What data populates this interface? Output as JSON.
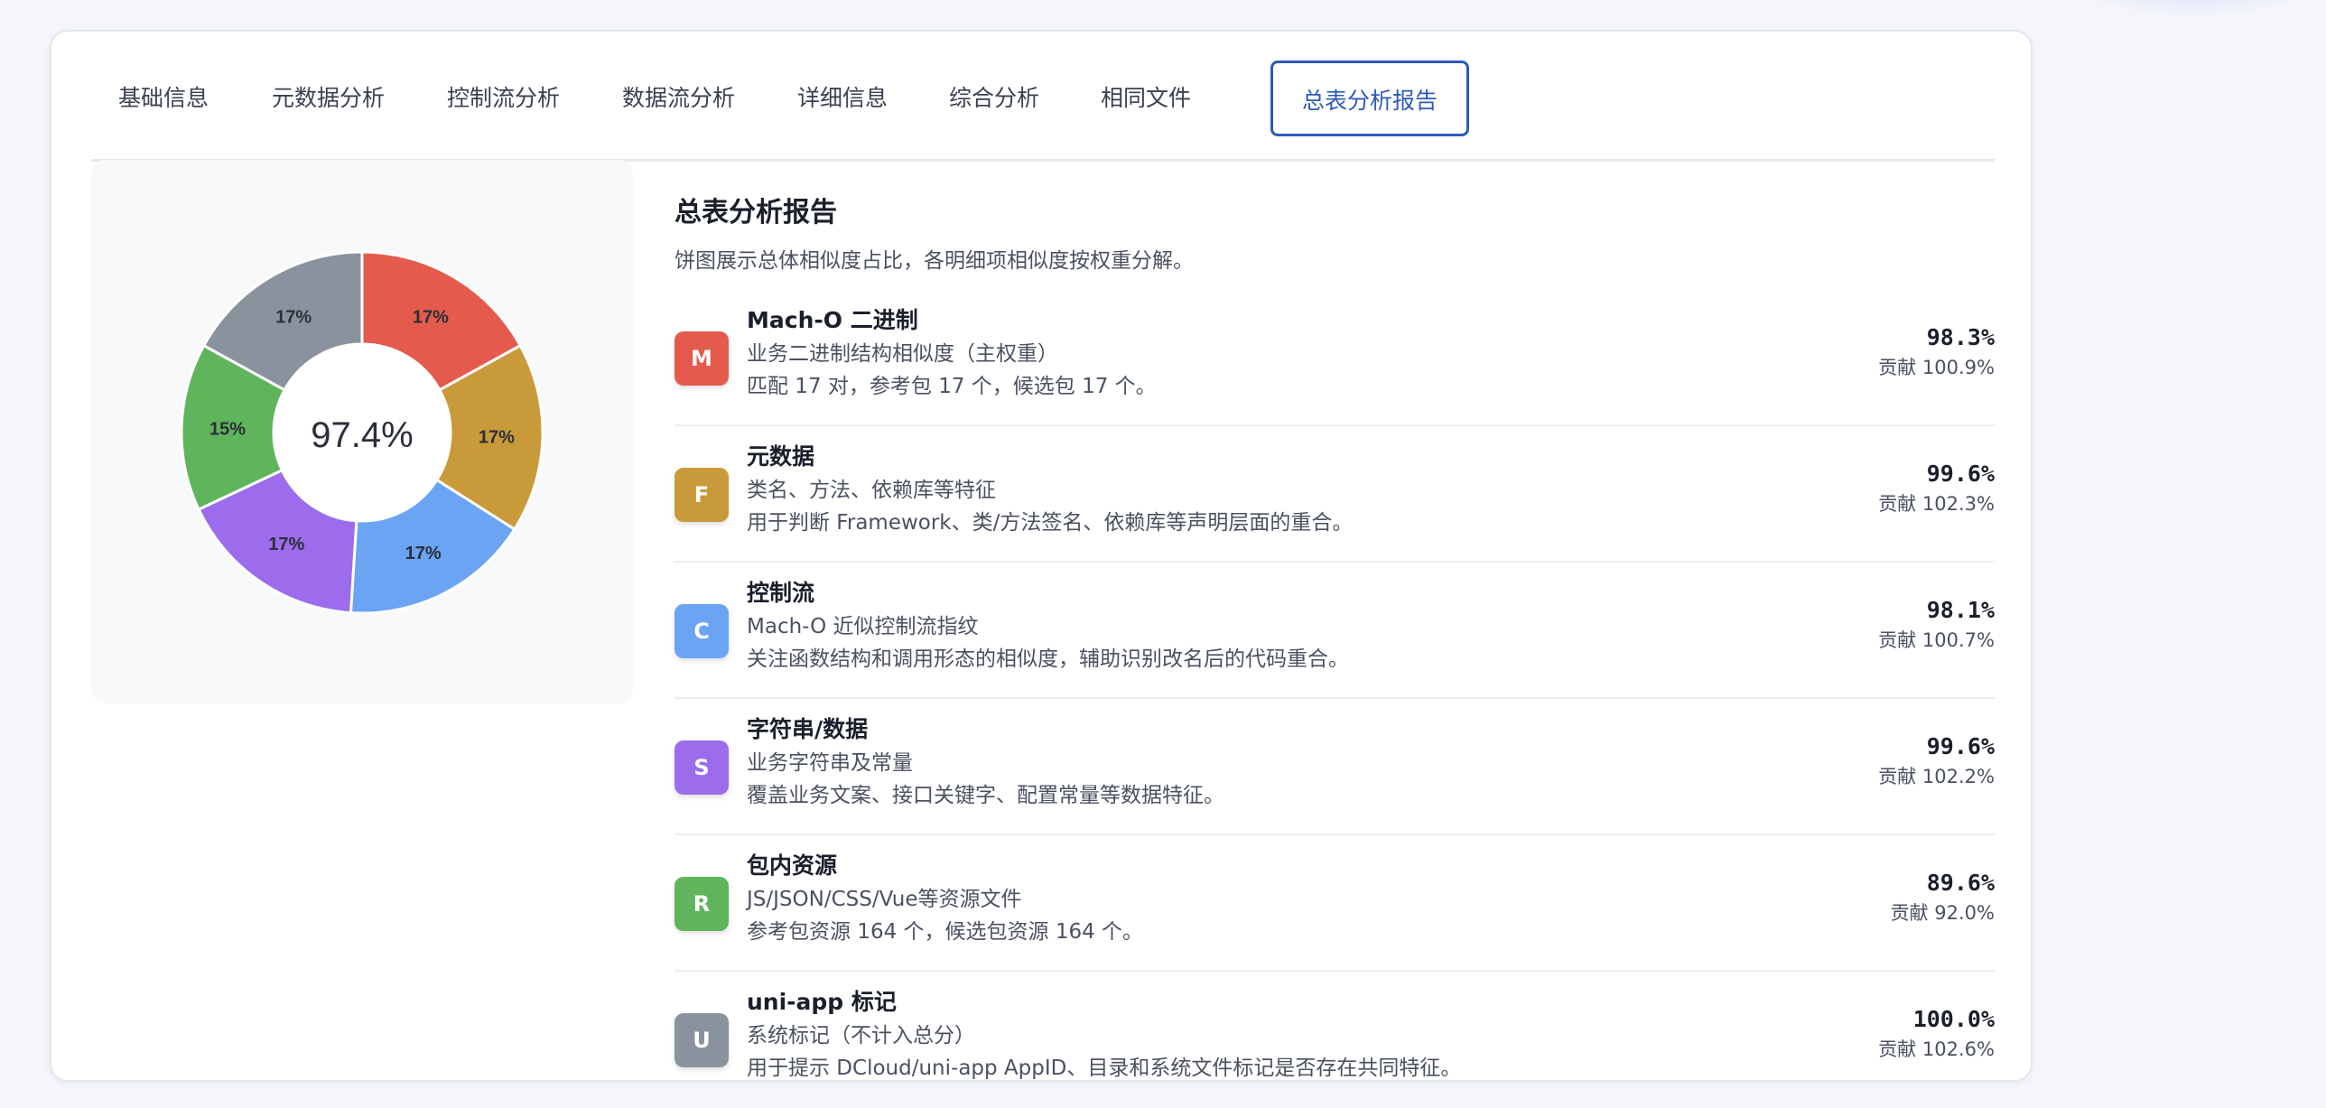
{
  "tabs": [
    {
      "label": "基础信息",
      "active": false
    },
    {
      "label": "元数据分析",
      "active": false
    },
    {
      "label": "控制流分析",
      "active": false
    },
    {
      "label": "数据流分析",
      "active": false
    },
    {
      "label": "详细信息",
      "active": false
    },
    {
      "label": "综合分析",
      "active": false
    },
    {
      "label": "相同文件",
      "active": false
    },
    {
      "label": "总表分析报告",
      "active": true
    }
  ],
  "report": {
    "title": "总表分析报告",
    "subtitle": "饼图展示总体相似度占比，各明细项相似度按权重分解。",
    "items": [
      {
        "badge": "M",
        "color": "#e45a4d",
        "title": "Mach-O 二进制",
        "desc": "业务二进制结构相似度（主权重）",
        "note": "匹配 17 对，参考包 17 个，候选包 17 个。",
        "score": "98.3%",
        "contrib": "贡献 100.9%"
      },
      {
        "badge": "F",
        "color": "#c99a3a",
        "title": "元数据",
        "desc": "类名、方法、依赖库等特征",
        "note": "用于判断 Framework、类/方法签名、依赖库等声明层面的重合。",
        "score": "99.6%",
        "contrib": "贡献 102.3%"
      },
      {
        "badge": "C",
        "color": "#6aa4f3",
        "title": "控制流",
        "desc": "Mach-O 近似控制流指纹",
        "note": "关注函数结构和调用形态的相似度，辅助识别改名后的代码重合。",
        "score": "98.1%",
        "contrib": "贡献 100.7%"
      },
      {
        "badge": "S",
        "color": "#9c6cec",
        "title": "字符串/数据",
        "desc": "业务字符串及常量",
        "note": "覆盖业务文案、接口关键字、配置常量等数据特征。",
        "score": "99.6%",
        "contrib": "贡献 102.2%"
      },
      {
        "badge": "R",
        "color": "#5fb45c",
        "title": "包内资源",
        "desc": "JS/JSON/CSS/Vue等资源文件",
        "note": "参考包资源 164 个，候选包资源 164 个。",
        "score": "89.6%",
        "contrib": "贡献 92.0%"
      },
      {
        "badge": "U",
        "color": "#8a939d",
        "title": "uni-app 标记",
        "desc": "系统标记（不计入总分）",
        "note": "用于提示 DCloud/uni-app AppID、目录和系统文件标记是否存在共同特征。",
        "score": "100.0%",
        "contrib": "贡献 102.6%"
      }
    ]
  },
  "chart_data": {
    "type": "pie",
    "donut": true,
    "center_label": "97.4%",
    "slices": [
      {
        "label": "17%",
        "value": 17,
        "color": "#e45a4d"
      },
      {
        "label": "17%",
        "value": 17,
        "color": "#c99a3a"
      },
      {
        "label": "17%",
        "value": 17,
        "color": "#6aa4f3"
      },
      {
        "label": "17%",
        "value": 17,
        "color": "#9c6cec"
      },
      {
        "label": "15%",
        "value": 15,
        "color": "#5fb45c"
      },
      {
        "label": "17%",
        "value": 17,
        "color": "#8a939d"
      }
    ]
  }
}
